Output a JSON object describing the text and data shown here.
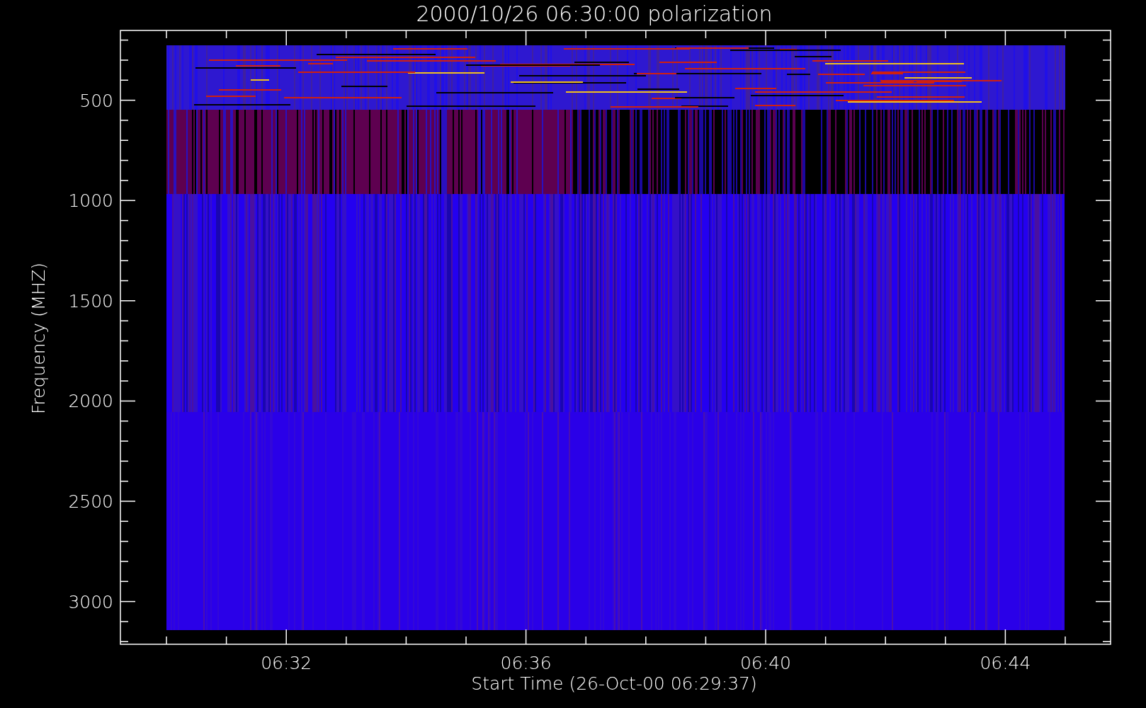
{
  "title": "2000/10/26 06:30:00 polarization",
  "ylabel": "Frequency (MHZ)",
  "xlabel": "Start Time (26-Oct-00 06:29:37)",
  "yticks": [
    "500",
    "1000",
    "1500",
    "2000",
    "2500",
    "3000"
  ],
  "xticks": [
    "06:32",
    "06:36",
    "06:40",
    "06:44"
  ]
}
